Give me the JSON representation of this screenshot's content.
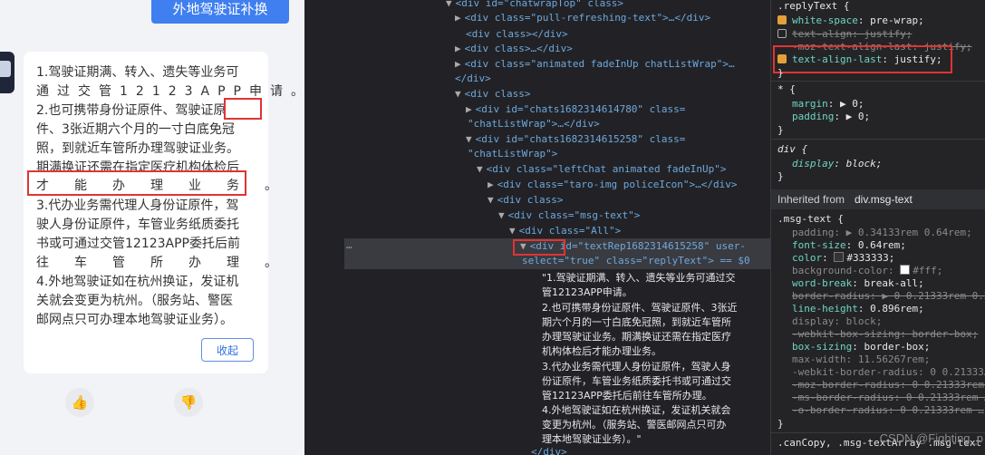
{
  "mobile": {
    "quick_button": "外地驾驶证补换",
    "lines": [
      "1.驾驶证期满、转入、遗失等业务可",
      "通过交管12123APP申请。",
      "2.也可携带身份证原件、驾驶证原",
      "件、3张近期六个月的一寸白底免冠",
      "照，到就近车管所办理驾驶证业务。",
      "期满换证还需在指定医疗机构体检后",
      "才能办理业务。",
      "3.代办业务需代理人身份证原件，驾",
      "驶人身份证原件，车管业务纸质委托",
      "书或可通过交管12123APP委托后前",
      "往车管所办理。",
      "4.外地驾驶证如在杭州换证，发证机",
      "关就会变更为杭州。（服务站、警医",
      "邮网点只可办理本地驾驶证业务）。"
    ],
    "collapse_label": "收起",
    "like_icon": "thumbs-up-icon",
    "dislike_icon": "thumbs-down-icon"
  },
  "elements": {
    "nodes": [
      {
        "top": "l0",
        "text": "<div id=\"chatwrapTop\" class>"
      },
      {
        "text": "<div class=\"pull-refreshing-text\">…</div>"
      },
      {
        "text": "<div class></div>"
      },
      {
        "text": "<div class>…</div>"
      },
      {
        "text": "<div class=\"animated fadeInUp chatListWrap\">…"
      },
      {
        "text": "</div>"
      },
      {
        "text": "<div class>"
      },
      {
        "text": "<div id=\"chats1682314614780\" class="
      },
      {
        "text": "\"chatListWrap\">…</div>"
      },
      {
        "text": "<div id=\"chats1682314615258\" class="
      },
      {
        "text": "\"chatListWrap\">"
      },
      {
        "text": "<div class=\"leftChat animated fadeInUp\">"
      },
      {
        "text": "<div class=\"taro-img policeIcon\">…</div>"
      },
      {
        "text": "<div class>"
      },
      {
        "text": "<div class=\"msg-text\">"
      },
      {
        "text": "<div class=\"All\">"
      },
      {
        "text": "<div id=\"textRep1682314615258\" user-"
      },
      {
        "text": "select=\"true\" class=\"replyText\"> == $0"
      }
    ],
    "text_lines": [
      "\"1.驾驶证期满、转入、遗失等业务可通过交",
      "管12123APP申请。",
      "2.也可携带身份证原件、驾驶证原件、3张近",
      "期六个月的一寸白底免冠照，到就近车管所",
      "办理驾驶证业务。期满换证还需在指定医疗",
      "机构体检后才能办理业务。",
      "3.代办业务需代理人身份证原件，驾驶人身",
      "份证原件，车管业务纸质委托书或可通过交",
      "管12123APP委托后前往车管所办理。",
      "4.外地驾驶证如在杭州换证，发证机关就会",
      "变更为杭州。（服务站、警医邮网点只可办",
      "理本地驾驶证业务）。\""
    ],
    "closing": "</div>",
    "ellipsis": "…"
  },
  "styles": {
    "reply_selector": ".replyText {",
    "reply_props": [
      {
        "name": "white-space",
        "value": "pre-wrap;",
        "checked": true,
        "struck": false
      },
      {
        "name": "text-align",
        "value": "justify;",
        "checked": false,
        "struck": true
      },
      {
        "name": "-moz-text-align-last",
        "value": "justify;",
        "checked": null,
        "struck": true
      },
      {
        "name": "text-align-last",
        "value": "justify;",
        "checked": true,
        "struck": false
      }
    ],
    "close": "}",
    "star_selector": "* {",
    "star_props": [
      {
        "name": "margin",
        "value": "0;"
      },
      {
        "name": "padding",
        "value": "0;"
      }
    ],
    "div_selector": "div {",
    "div_props": [
      {
        "name": "display",
        "value": "block;"
      }
    ],
    "inherited_label": "Inherited from",
    "inherited_target": "div.msg-text",
    "msg_selector": ".msg-text {",
    "msg_props": [
      {
        "name": "padding",
        "value": "0.34133rem 0.64rem;",
        "struck": false,
        "dim": true
      },
      {
        "name": "font-size",
        "value": "0.64rem;",
        "struck": false,
        "dim": false
      },
      {
        "name": "color",
        "value": "#333333;",
        "struck": false,
        "dim": false
      },
      {
        "name": "background-color",
        "value": "#fff;",
        "struck": false,
        "dim": true
      },
      {
        "name": "word-break",
        "value": "break-all;",
        "struck": false,
        "dim": false
      },
      {
        "name": "border-radius",
        "value": "0 0.21333rem 0.2…",
        "struck": true,
        "dim": true
      },
      {
        "name": "line-height",
        "value": "0.896rem;",
        "struck": false,
        "dim": false
      },
      {
        "name": "display",
        "value": "block;",
        "struck": false,
        "dim": true
      },
      {
        "name": "-webkit-box-sizing",
        "value": "border-box;",
        "struck": true,
        "dim": true
      },
      {
        "name": "box-sizing",
        "value": "border-box;",
        "struck": false,
        "dim": false
      },
      {
        "name": "max-width",
        "value": "11.56267rem;",
        "struck": false,
        "dim": true
      },
      {
        "name": "-webkit-border-radius",
        "value": "0 0.21333…",
        "struck": false,
        "dim": true
      },
      {
        "name": "-moz-border-radius",
        "value": "0 0.21333rem …",
        "struck": true,
        "dim": true
      },
      {
        "name": "-ms-border-radius",
        "value": "0 0.21333rem …",
        "struck": true,
        "dim": true
      },
      {
        "name": "-o-border-radius",
        "value": "0 0.21333rem …",
        "struck": true,
        "dim": true
      }
    ],
    "bottom_line": ".canCopy, .msg-textArray .msg-text",
    "watermark": "CSDN @Fighting_p"
  }
}
